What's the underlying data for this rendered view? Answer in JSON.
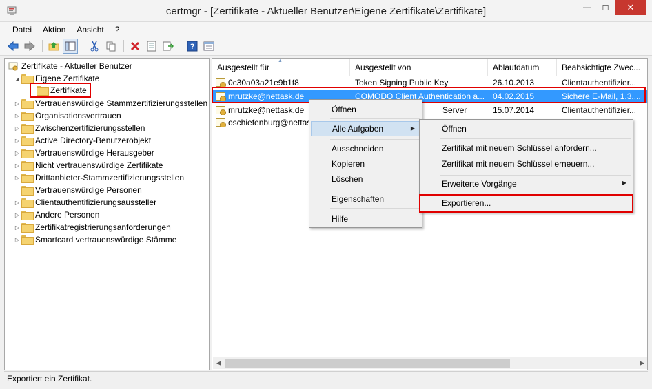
{
  "window": {
    "title": "certmgr - [Zertifikate - Aktueller Benutzer\\Eigene Zertifikate\\Zertifikate]",
    "minimize": "—",
    "maximize": "☐",
    "close": "✕"
  },
  "menubar": [
    "Datei",
    "Aktion",
    "Ansicht",
    "?"
  ],
  "toolbar": {
    "icons": [
      "back-icon",
      "forward-icon",
      "up-folder-icon",
      "show-tree-icon",
      "cut-icon",
      "copy-icon",
      "delete-icon",
      "properties-icon",
      "export-list-icon",
      "help-icon",
      "mmc-console-icon"
    ]
  },
  "tree": {
    "root": "Zertifikate - Aktueller Benutzer",
    "expanded": "Eigene Zertifikate",
    "selected": "Zertifikate",
    "items": [
      "Vertrauenswürdige Stammzertifizierungsstellen",
      "Organisationsvertrauen",
      "Zwischenzertifizierungsstellen",
      "Active Directory-Benutzerobjekt",
      "Vertrauenswürdige Herausgeber",
      "Nicht vertrauenswürdige Zertifikate",
      "Drittanbieter-Stammzertifizierungsstellen",
      "Vertrauenswürdige Personen",
      "Clientauthentifizierungsaussteller",
      "Andere Personen",
      "Zertifikatregistrierungsanforderungen",
      "Smartcard vertrauenswürdige Stämme"
    ]
  },
  "list": {
    "columns": [
      "Ausgestellt für",
      "Ausgestellt von",
      "Ablaufdatum",
      "Beabsichtigte Zwec..."
    ],
    "rows": [
      {
        "for": "0c30a03a21e9b1f8",
        "by": "Token Signing Public Key",
        "expires": "26.10.2013",
        "purpose": "Clientauthentifizier..."
      },
      {
        "for": "mrutzke@nettask.de",
        "by": "COMODO Client Authentication a...",
        "expires": "04.02.2015",
        "purpose": "Sichere E-Mail, 1.3...."
      },
      {
        "for": "mrutzke@nettask.de",
        "by": "Server",
        "expires": "15.07.2014",
        "purpose": "Clientauthentifizier..."
      },
      {
        "for": "oschiefenburg@nettas",
        "by": "",
        "expires": "",
        "purpose": ""
      }
    ]
  },
  "context_menu": {
    "items": [
      "Öffnen",
      "Alle Aufgaben",
      "Ausschneiden",
      "Kopieren",
      "Löschen",
      "Eigenschaften",
      "Hilfe"
    ],
    "submenu_arrow": "▶"
  },
  "submenu": {
    "items": [
      "Öffnen",
      "Zertifikat mit neuem Schlüssel anfordern...",
      "Zertifikat mit neuem Schlüssel erneuern...",
      "Erweiterte Vorgänge",
      "Exportieren..."
    ]
  },
  "status": "Exportiert ein Zertifikat.",
  "colors": {
    "selection": "#3399ff",
    "highlight_box": "#e00000",
    "close_button": "#c7372f"
  }
}
